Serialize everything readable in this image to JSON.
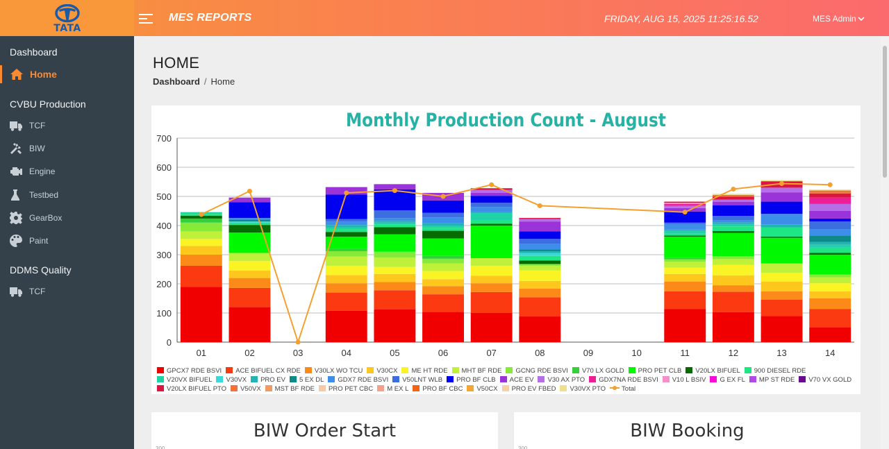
{
  "brand": {
    "logo_text": "TATA",
    "app_title": "MES REPORTS"
  },
  "header": {
    "datetime": "FRIDAY, AUG 15, 2025 11:25:16.52",
    "user": "MES Admin"
  },
  "sidebar": {
    "sections": [
      {
        "label": "Dashboard"
      },
      {
        "label": "CVBU Production"
      },
      {
        "label": "DDMS Quality"
      }
    ],
    "items": [
      {
        "label": "Home",
        "icon": "home-icon"
      },
      {
        "label": "TCF",
        "icon": "truck-icon"
      },
      {
        "label": "BIW",
        "icon": "tools-icon"
      },
      {
        "label": "Engine",
        "icon": "engine-icon"
      },
      {
        "label": "Testbed",
        "icon": "testbed-icon"
      },
      {
        "label": "GearBox",
        "icon": "gear-icon"
      },
      {
        "label": "Paint",
        "icon": "palette-icon"
      },
      {
        "label": "TCF",
        "icon": "truck-icon"
      }
    ]
  },
  "page": {
    "title": "HOME",
    "breadcrumb": [
      "Dashboard",
      "Home"
    ]
  },
  "bottom_cards": [
    {
      "title": "BIW Order Start",
      "y_tick": "300"
    },
    {
      "title": "BIW Booking",
      "y_tick": "300"
    }
  ],
  "chart_data": {
    "type": "bar",
    "title": "Monthly Production Count - August",
    "categories": [
      "01",
      "02",
      "03",
      "04",
      "05",
      "06",
      "07",
      "08",
      "09",
      "10",
      "11",
      "12",
      "13",
      "14"
    ],
    "ylim": [
      0,
      700
    ],
    "yticks": [
      0,
      100,
      200,
      300,
      400,
      500,
      600,
      700
    ],
    "stacked": true,
    "grid": true,
    "legend_position": "bottom",
    "series": [
      {
        "name": "GPCX7 RDE BSVI",
        "color": "#f00000",
        "values": [
          190,
          120,
          0,
          108,
          112,
          104,
          100,
          88,
          0,
          0,
          114,
          103,
          90,
          50
        ]
      },
      {
        "name": "ACE BIFUEL CX RDE",
        "color": "#fb3a12",
        "values": [
          72,
          66,
          0,
          62,
          66,
          60,
          72,
          66,
          0,
          0,
          60,
          70,
          56,
          64
        ]
      },
      {
        "name": "V30LX WO TCU",
        "color": "#fc8a18",
        "values": [
          38,
          34,
          0,
          32,
          28,
          28,
          30,
          30,
          0,
          0,
          34,
          22,
          28,
          36
        ]
      },
      {
        "name": "V30CX",
        "color": "#fdc71e",
        "values": [
          30,
          26,
          0,
          28,
          28,
          24,
          26,
          26,
          0,
          0,
          26,
          34,
          34,
          24
        ]
      },
      {
        "name": "ME HT RDE",
        "color": "#fbf425",
        "values": [
          24,
          32,
          0,
          32,
          24,
          28,
          34,
          36,
          0,
          0,
          22,
          36,
          30,
          28
        ]
      },
      {
        "name": "MHT BF RDE",
        "color": "#bff03a",
        "values": [
          26,
          28,
          0,
          32,
          32,
          26,
          26,
          16,
          0,
          0,
          20,
          20,
          32,
          20
        ]
      },
      {
        "name": "GCNG RDE BSVI",
        "color": "#88ea38",
        "values": [
          30,
          0,
          0,
          18,
          20,
          16,
          0,
          6,
          0,
          0,
          8,
          10,
          0,
          10
        ]
      },
      {
        "name": "V70 LX GOLD",
        "color": "#33d03a",
        "values": [
          14,
          0,
          0,
          8,
          0,
          10,
          0,
          0,
          0,
          0,
          6,
          0,
          0,
          0
        ]
      },
      {
        "name": "PRO PET CLB",
        "color": "#00f800",
        "values": [
          0,
          70,
          0,
          42,
          60,
          60,
          112,
          0,
          0,
          0,
          72,
          80,
          88,
          68
        ]
      },
      {
        "name": "V20LX BIFUEL",
        "color": "#066b00",
        "values": [
          10,
          26,
          0,
          16,
          24,
          26,
          6,
          12,
          0,
          0,
          4,
          6,
          4,
          6
        ]
      },
      {
        "name": "900 DIESEL RDE",
        "color": "#1fe685",
        "values": [
          6,
          8,
          0,
          10,
          10,
          10,
          12,
          16,
          0,
          0,
          6,
          16,
          32,
          18
        ]
      },
      {
        "name": "V20VX BIFUEL",
        "color": "#1ed4a6",
        "values": [
          6,
          0,
          0,
          6,
          6,
          8,
          24,
          0,
          0,
          0,
          10,
          8,
          0,
          10
        ]
      },
      {
        "name": "V30VX",
        "color": "#3ad8d8",
        "values": [
          0,
          4,
          0,
          0,
          0,
          0,
          0,
          10,
          0,
          0,
          0,
          0,
          0,
          0
        ]
      },
      {
        "name": "PRO EV",
        "color": "#22b4b4",
        "values": [
          0,
          0,
          0,
          8,
          6,
          8,
          4,
          6,
          0,
          0,
          4,
          6,
          10,
          10
        ]
      },
      {
        "name": "5 EX DL",
        "color": "#0c8a88",
        "values": [
          0,
          6,
          0,
          0,
          0,
          0,
          0,
          6,
          0,
          0,
          0,
          0,
          0,
          22
        ]
      },
      {
        "name": "GDX7 RDE BSVI",
        "color": "#3c8ee8",
        "values": [
          0,
          6,
          0,
          12,
          10,
          20,
          18,
          20,
          0,
          0,
          20,
          8,
          36,
          22
        ]
      },
      {
        "name": "V50LNT WLB",
        "color": "#3c6ee0",
        "values": [
          0,
          0,
          0,
          8,
          26,
          16,
          14,
          16,
          0,
          0,
          4,
          14,
          0,
          26
        ]
      },
      {
        "name": "PRO BF CLB",
        "color": "#0000f0",
        "values": [
          0,
          54,
          0,
          84,
          72,
          42,
          24,
          26,
          0,
          0,
          38,
          36,
          42,
          10
        ]
      },
      {
        "name": "ACE EV",
        "color": "#9a34d8",
        "values": [
          0,
          16,
          0,
          26,
          18,
          26,
          10,
          34,
          0,
          0,
          12,
          12,
          32,
          26
        ]
      },
      {
        "name": "V30 AX PTO",
        "color": "#b66ee8",
        "values": [
          0,
          0,
          0,
          0,
          0,
          0,
          10,
          8,
          0,
          0,
          8,
          8,
          16,
          24
        ]
      },
      {
        "name": "GDX7NA RDE BSVI",
        "color": "#ee1e96",
        "values": [
          0,
          0,
          0,
          0,
          0,
          0,
          0,
          0,
          0,
          0,
          6,
          0,
          0,
          22
        ]
      },
      {
        "name": "V10 L BSIV",
        "color": "#f590c8",
        "values": [
          0,
          0,
          0,
          0,
          0,
          0,
          0,
          0,
          0,
          0,
          4,
          0,
          0,
          0
        ]
      },
      {
        "name": "G EX FL",
        "color": "#fa0ad8",
        "values": [
          0,
          0,
          0,
          0,
          0,
          0,
          0,
          0,
          0,
          0,
          0,
          0,
          0,
          0
        ]
      },
      {
        "name": "MP ST RDE",
        "color": "#b44ae6",
        "values": [
          0,
          0,
          0,
          0,
          0,
          0,
          0,
          0,
          0,
          0,
          0,
          0,
          0,
          0
        ]
      },
      {
        "name": "V70 VX GOLD",
        "color": "#6a0a8e",
        "values": [
          0,
          0,
          0,
          0,
          0,
          0,
          0,
          0,
          0,
          0,
          0,
          0,
          0,
          0
        ]
      },
      {
        "name": "V20LX BIFUEL PTO",
        "color": "#dc1440",
        "values": [
          0,
          0,
          0,
          0,
          0,
          0,
          6,
          4,
          0,
          0,
          4,
          10,
          22,
          14
        ]
      },
      {
        "name": "V50VX",
        "color": "#f6703c",
        "values": [
          0,
          0,
          0,
          0,
          0,
          0,
          0,
          0,
          0,
          0,
          0,
          6,
          0,
          6
        ]
      },
      {
        "name": "MST BF RDE",
        "color": "#f29a64",
        "values": [
          0,
          0,
          0,
          0,
          0,
          0,
          0,
          0,
          0,
          0,
          0,
          0,
          0,
          0
        ]
      },
      {
        "name": "PRO PET CBC",
        "color": "#f7caa5",
        "values": [
          0,
          0,
          0,
          0,
          0,
          0,
          0,
          0,
          0,
          0,
          0,
          0,
          0,
          0
        ]
      },
      {
        "name": "M EX L",
        "color": "#f6a08a",
        "values": [
          0,
          0,
          0,
          0,
          0,
          0,
          0,
          0,
          0,
          0,
          0,
          0,
          0,
          0
        ]
      },
      {
        "name": "PRO BF CBC",
        "color": "#f26414",
        "values": [
          0,
          0,
          0,
          0,
          0,
          0,
          0,
          0,
          0,
          0,
          0,
          0,
          0,
          4
        ]
      },
      {
        "name": "V50CX",
        "color": "#f5a630",
        "values": [
          0,
          0,
          0,
          0,
          0,
          0,
          0,
          0,
          0,
          0,
          0,
          0,
          0,
          0
        ]
      },
      {
        "name": "PRO EV FBED",
        "color": "#f8d2a6",
        "values": [
          0,
          0,
          0,
          0,
          0,
          0,
          0,
          0,
          0,
          0,
          0,
          0,
          0,
          0
        ]
      },
      {
        "name": "V30VX PTO",
        "color": "#efe08c",
        "values": [
          0,
          0,
          0,
          0,
          0,
          0,
          0,
          0,
          0,
          0,
          0,
          4,
          4,
          4
        ]
      }
    ],
    "line": {
      "name": "Total",
      "color": "#f5a02e",
      "values": [
        438,
        518,
        0,
        512,
        520,
        500,
        540,
        468,
        null,
        null,
        446,
        525,
        544,
        540
      ]
    }
  }
}
